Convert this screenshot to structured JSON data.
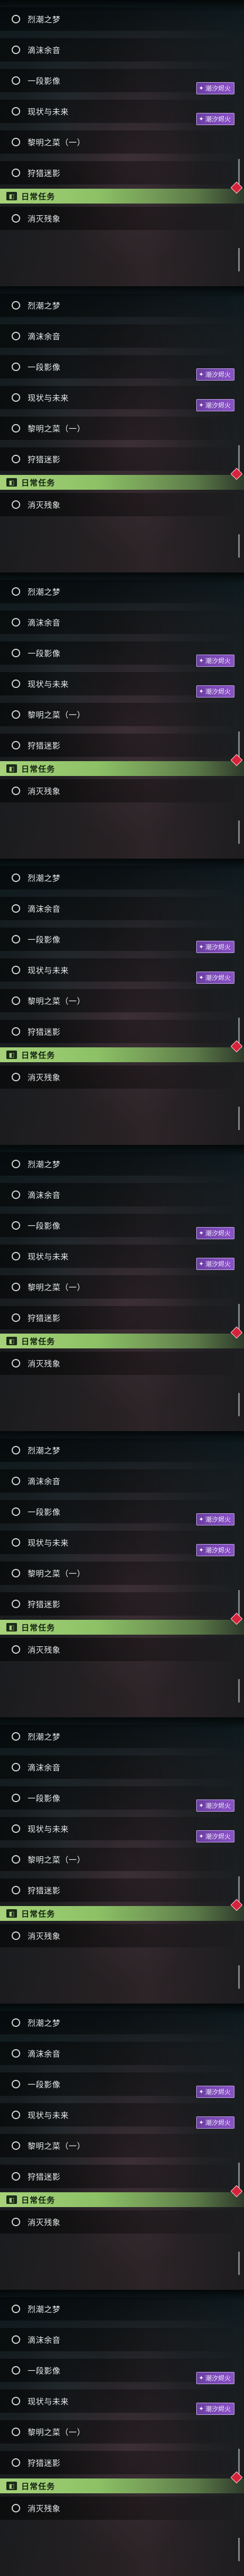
{
  "task_panels": [
    {
      "tasks": [
        {
          "label": "烈潮之梦",
          "badge": ""
        },
        {
          "label": "滴沫余音",
          "badge": ""
        },
        {
          "label": "一段影像",
          "badge": "潮汐烬火"
        },
        {
          "label": "现状与未来",
          "badge": "潮汐烬火"
        },
        {
          "label": "黎明之菜（一）",
          "badge": ""
        },
        {
          "label": "狩猎迷影",
          "badge": ""
        }
      ],
      "section_title": "日常任务",
      "daily_tasks": [
        {
          "label": "消灭残象"
        }
      ]
    },
    {
      "tasks": [
        {
          "label": "烈潮之梦",
          "badge": ""
        },
        {
          "label": "滴沫余音",
          "badge": ""
        },
        {
          "label": "一段影像",
          "badge": "潮汐烬火"
        },
        {
          "label": "现状与未来",
          "badge": "潮汐烬火"
        },
        {
          "label": "黎明之菜（一）",
          "badge": ""
        },
        {
          "label": "狩猎迷影",
          "badge": ""
        }
      ],
      "section_title": "日常任务",
      "daily_tasks": [
        {
          "label": "消灭残象"
        }
      ]
    },
    {
      "tasks": [
        {
          "label": "烈潮之梦",
          "badge": ""
        },
        {
          "label": "滴沫余音",
          "badge": ""
        },
        {
          "label": "一段影像",
          "badge": "潮汐烬火"
        },
        {
          "label": "现状与未来",
          "badge": "潮汐烬火"
        },
        {
          "label": "黎明之菜（一）",
          "badge": ""
        },
        {
          "label": "狩猎迷影",
          "badge": ""
        }
      ],
      "section_title": "日常任务",
      "daily_tasks": [
        {
          "label": "消灭残象"
        }
      ]
    },
    {
      "tasks": [
        {
          "label": "烈潮之梦",
          "badge": ""
        },
        {
          "label": "滴沫余音",
          "badge": ""
        },
        {
          "label": "一段影像",
          "badge": "潮汐烬火"
        },
        {
          "label": "现状与未来",
          "badge": "潮汐烬火"
        },
        {
          "label": "黎明之菜（一）",
          "badge": ""
        },
        {
          "label": "狩猎迷影",
          "badge": ""
        }
      ],
      "section_title": "日常任务",
      "daily_tasks": [
        {
          "label": "消灭残象"
        }
      ]
    },
    {
      "tasks": [
        {
          "label": "烈潮之梦",
          "badge": ""
        },
        {
          "label": "滴沫余音",
          "badge": ""
        },
        {
          "label": "一段影像",
          "badge": "潮汐烬火"
        },
        {
          "label": "现状与未来",
          "badge": "潮汐烬火"
        },
        {
          "label": "黎明之菜（一）",
          "badge": ""
        },
        {
          "label": "狩猎迷影",
          "badge": ""
        }
      ],
      "section_title": "日常任务",
      "daily_tasks": [
        {
          "label": "消灭残象"
        }
      ]
    },
    {
      "tasks": [
        {
          "label": "烈潮之梦",
          "badge": ""
        },
        {
          "label": "滴沫余音",
          "badge": ""
        },
        {
          "label": "一段影像",
          "badge": "潮汐烬火"
        },
        {
          "label": "现状与未来",
          "badge": "潮汐烬火"
        },
        {
          "label": "黎明之菜（一）",
          "badge": ""
        },
        {
          "label": "狩猎迷影",
          "badge": ""
        }
      ],
      "section_title": "日常任务",
      "daily_tasks": [
        {
          "label": "消灭残象"
        }
      ]
    },
    {
      "tasks": [
        {
          "label": "烈潮之梦",
          "badge": ""
        },
        {
          "label": "滴沫余音",
          "badge": ""
        },
        {
          "label": "一段影像",
          "badge": "潮汐烬火"
        },
        {
          "label": "现状与未来",
          "badge": "潮汐烬火"
        },
        {
          "label": "黎明之菜（一）",
          "badge": ""
        },
        {
          "label": "狩猎迷影",
          "badge": ""
        }
      ],
      "section_title": "日常任务",
      "daily_tasks": [
        {
          "label": "消灭残象"
        }
      ]
    },
    {
      "tasks": [
        {
          "label": "烈潮之梦",
          "badge": ""
        },
        {
          "label": "滴沫余音",
          "badge": ""
        },
        {
          "label": "一段影像",
          "badge": "潮汐烬火"
        },
        {
          "label": "现状与未来",
          "badge": "潮汐烬火"
        },
        {
          "label": "黎明之菜（一）",
          "badge": ""
        },
        {
          "label": "狩猎迷影",
          "badge": ""
        }
      ],
      "section_title": "日常任务",
      "daily_tasks": [
        {
          "label": "消灭残象"
        }
      ]
    },
    {
      "tasks": [
        {
          "label": "烈潮之梦",
          "badge": ""
        },
        {
          "label": "滴沫余音",
          "badge": ""
        },
        {
          "label": "一段影像",
          "badge": "潮汐烬火"
        },
        {
          "label": "现状与未来",
          "badge": "潮汐烬火"
        },
        {
          "label": "黎明之菜（一）",
          "badge": ""
        },
        {
          "label": "狩猎迷影",
          "badge": ""
        }
      ],
      "section_title": "日常任务",
      "daily_tasks": [
        {
          "label": "消灭残象"
        }
      ]
    }
  ],
  "colors": {
    "section_accent": "#a7d27a",
    "badge_purple": "#7a48b4",
    "marker_red": "#d6233b"
  },
  "icons": {
    "task_status": "circle-outline-icon",
    "section": "daily-task-icon",
    "badge": "sparkle-icon",
    "marker": "red-diamond-icon"
  }
}
